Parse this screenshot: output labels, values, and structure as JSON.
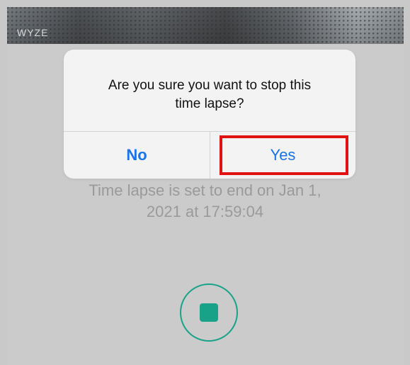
{
  "camera": {
    "logo_text": "WYZE"
  },
  "dialog": {
    "message_line1": "Are you sure you want to stop this",
    "message_line2": "time lapse?",
    "no_label": "No",
    "yes_label": "Yes"
  },
  "time_lapse": {
    "status_line1": "Time lapse is set to end on Jan 1,",
    "status_line2": "2021 at 17:59:04"
  },
  "colors": {
    "accent_teal": "#18a389",
    "dialog_button_blue": "#1a73e8",
    "highlight_red": "#e11212",
    "background_gray": "#cbcbcb"
  },
  "icons": {
    "stop": "stop-icon"
  }
}
